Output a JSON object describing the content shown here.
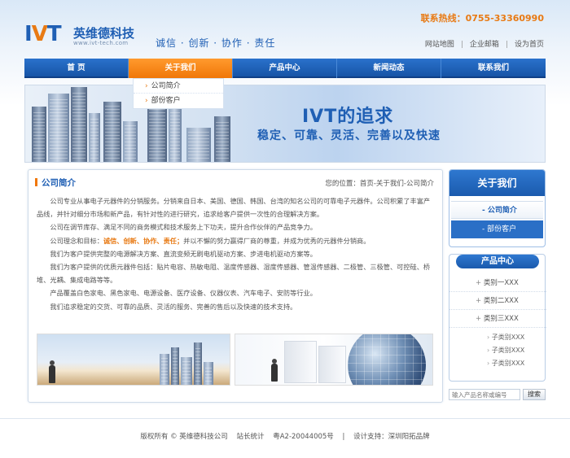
{
  "header": {
    "logo_mark_a": "I",
    "logo_mark_v": "V",
    "logo_mark_t": "T",
    "company_name": "英维德科技",
    "website": "www.ivt-tech.com",
    "slogan": "诚信 · 创新 · 协作 · 责任",
    "hotline": "联系热线：0755-33360990",
    "links": [
      "网站地图",
      "企业邮箱",
      "设为首页"
    ]
  },
  "nav": {
    "items": [
      "首 页",
      "关于我们",
      "产品中心",
      "新闻动态",
      "联系我们"
    ],
    "active_index": 1,
    "dropdown": [
      "公司简介",
      "部份客户"
    ]
  },
  "banner": {
    "title": "IVT的追求",
    "subtitle": "稳定、可靠、灵活、完善以及快速"
  },
  "main": {
    "title": "公司简介",
    "breadcrumb": "您的位置：首页-关于我们-公司简介",
    "paragraphs": [
      "公司专业从事电子元器件的分销服务。分销来自日本、美国、德国、韩国、台湾的知名公司的可靠电子元器件。公司积累了丰富产品线，并针对细分市场和新产品，有针对性的进行研究，追求给客户提供一次性的合理解决方案。",
      "公司在调节库存、满足不同的商务模式和技术服务上下功夫，提升合作伙伴的产品竞争力。",
      "并以不懈的努力赢得厂商的尊重，并成为优秀的元器件分销商。",
      "我们为客户提供完整的电源解决方案、直流变频无刷电机驱动方案、步进电机驱动方案等。",
      "我们为客户提供的优质元器件包括：贴片电容、热敏电阻、温度传感器、湿度传感器、管温传感器、二极管、三极管、可控硅、桥堆、光耦、集成电路等等。",
      "产品覆盖白色家电、黑色家电、电源设备、医疗设备、仪器仪表、汽车电子、安防等行业。",
      "我们追求稳定的交货、可靠的品质、灵活的服务、完善的售后以及快速的技术支持。"
    ],
    "concept_prefix": "公司理念和目标：",
    "concept_highlight": "诚信、创新、协作、责任；"
  },
  "sidebar": {
    "about_title": "关于我们",
    "about_items": [
      "公司简介",
      "部份客户"
    ],
    "about_active_index": 0,
    "products_title": "产品中心",
    "product_categories": [
      "类别一XXX",
      "类别二XXX",
      "类别三XXX"
    ],
    "product_subcategories": [
      "子类别XXX",
      "子类别XXX",
      "子类别XXX"
    ],
    "search_placeholder": "输入产品名称或编号",
    "search_button": "搜索"
  },
  "footer": {
    "copyright": "版权所有 © 英维德科技公司",
    "stats": "站长统计",
    "icp": "粤A2-20044005号",
    "support": "设计支持：深圳阳拓品牌"
  },
  "colors": {
    "brand_blue": "#1f5fb4",
    "accent_orange": "#f07708",
    "nav_blue": "#1754a6"
  }
}
